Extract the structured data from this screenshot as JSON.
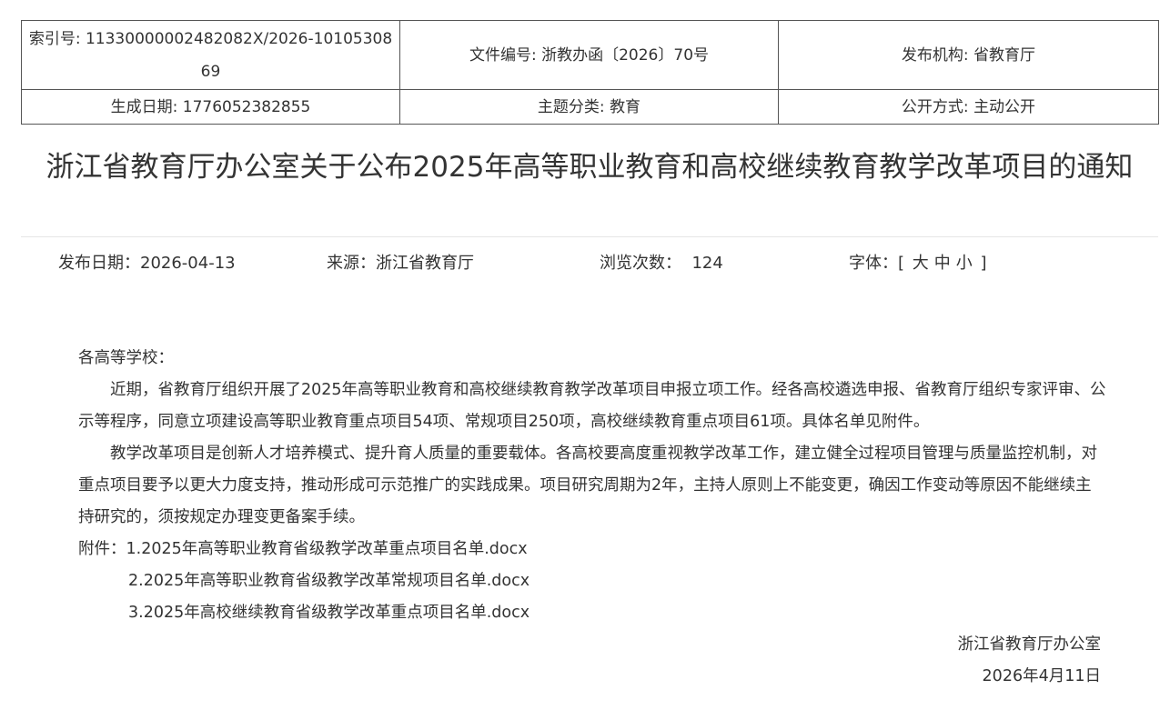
{
  "meta": {
    "index_label": "索引号: ",
    "index_value": "11330000002482082X/2026-1010530869",
    "doc_no_label": "文件编号: ",
    "doc_no_value": "浙教办函〔2026〕70号",
    "publisher_label": "发布机构: ",
    "publisher_value": "省教育厅",
    "gen_date_label": "生成日期: ",
    "gen_date_value": "1776052382855",
    "category_label": "主题分类: ",
    "category_value": "教育",
    "disclosure_label": "公开方式: ",
    "disclosure_value": "主动公开"
  },
  "article": {
    "title": "浙江省教育厅办公室关于公布2025年高等职业教育和高校继续教育教学改革项目的通知"
  },
  "info": {
    "date_label": "发布日期：",
    "date_value": "2026-04-13",
    "source_label": "来源：",
    "source_value": "浙江省教育厅",
    "views_label": "浏览次数：",
    "views_value": "124",
    "font_label": "字体：",
    "font_open": "[",
    "font_large": "大",
    "font_medium": "中",
    "font_small": "小",
    "font_close": "]"
  },
  "body": {
    "salutation": "各高等学校：",
    "para1": "近期，省教育厅组织开展了2025年高等职业教育和高校继续教育教学改革项目申报立项工作。经各高校遴选申报、省教育厅组织专家评审、公示等程序，同意立项建设高等职业教育重点项目54项、常规项目250项，高校继续教育重点项目61项。具体名单见附件。",
    "para2": "教学改革项目是创新人才培养模式、提升育人质量的重要载体。各高校要高度重视教学改革工作，建立健全过程项目管理与质量监控机制，对重点项目要予以更大力度支持，推动形成可示范推广的实践成果。项目研究周期为2年，主持人原则上不能变更，确因工作变动等原因不能继续主持研究的，须按规定办理变更备案手续。",
    "attachments_label": "附件：",
    "attachments": [
      "1.2025年高等职业教育省级教学改革重点项目名单.docx",
      "2.2025年高等职业教育省级教学改革常规项目名单.docx",
      "3.2025年高校继续教育省级教学改革重点项目名单.docx"
    ],
    "signature": "浙江省教育厅办公室",
    "sign_date": "2026年4月11日"
  }
}
